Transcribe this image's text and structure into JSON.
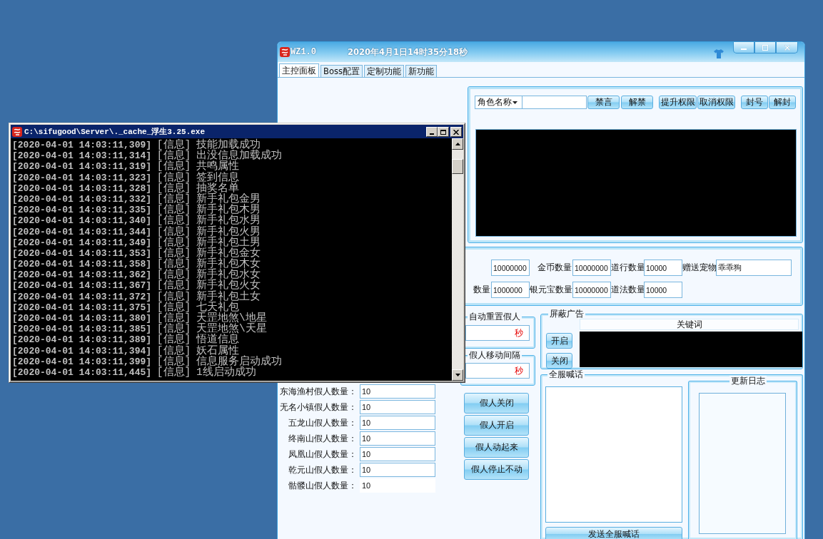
{
  "main_window": {
    "title": "WZ1.0",
    "clock": "2020年4月1日14时35分18秒",
    "tabs": [
      {
        "label": "主控面板",
        "selected": true
      },
      {
        "label": "Boss配置",
        "selected": false
      },
      {
        "label": "定制功能",
        "selected": false
      },
      {
        "label": "新功能",
        "selected": false
      }
    ],
    "player_panel": {
      "search_by": "角色名称",
      "button_groups": [
        [
          "禁言",
          "解禁"
        ],
        [
          "提升权限",
          "取消权限"
        ],
        [
          "封号",
          "解封"
        ]
      ]
    },
    "grant_panel": {
      "rows": [
        [
          {
            "value": "10000000"
          },
          {
            "label": "金币数量",
            "value": "10000000"
          },
          {
            "label": "道行数量",
            "value": "10000"
          },
          {
            "label": "赠送宠物",
            "value": "乖乖狗"
          }
        ],
        [
          {
            "label": "数量",
            "value": "1000000"
          },
          {
            "label": "银元宝数量",
            "value": "10000000"
          },
          {
            "label": "道法数量",
            "value": "10000"
          }
        ]
      ]
    },
    "fake_players": {
      "rows": [
        {
          "label": "东海渔村假人数量：",
          "value": "10",
          "kind": "input"
        },
        {
          "label": "无名小镇假人数量：",
          "value": "10",
          "kind": "input"
        },
        {
          "label": "五龙山假人数量：",
          "value": "10",
          "kind": "input"
        },
        {
          "label": "终南山假人数量：",
          "value": "10",
          "kind": "input"
        },
        {
          "label": "凤凰山假人数量：",
          "value": "10",
          "kind": "input"
        },
        {
          "label": "乾元山假人数量：",
          "value": "10",
          "kind": "input"
        },
        {
          "label": "骷髅山假人数量：",
          "value": "10",
          "kind": "plain"
        }
      ]
    },
    "timers": [
      {
        "title": "自动重置假人",
        "unit": "秒"
      },
      {
        "title": "假人移动间隔",
        "unit": "秒"
      }
    ],
    "fake_buttons": [
      "假人关闭",
      "假人开启",
      "假人动起来",
      "假人停止不动"
    ],
    "ad_filter": {
      "title": "屏蔽广告",
      "column": "关键词",
      "buttons": [
        "开启",
        "关闭"
      ]
    },
    "broadcast": {
      "title": "全服喊话",
      "send_button": "发送全服喊话",
      "changelog_title": "更新日志"
    }
  },
  "console_window": {
    "title": "C:\\sifugood\\Server\\._cache_浮生3.25.exe",
    "lines": [
      {
        "time": "[2020-04-01 14:03:11,309]",
        "level": "[信息]",
        "message": "技能加载成功"
      },
      {
        "time": "[2020-04-01 14:03:11,314]",
        "level": "[信息]",
        "message": "出没信息加载成功"
      },
      {
        "time": "[2020-04-01 14:03:11,319]",
        "level": "[信息]",
        "message": "共鸣属性"
      },
      {
        "time": "[2020-04-01 14:03:11,323]",
        "level": "[信息]",
        "message": "签到信息"
      },
      {
        "time": "[2020-04-01 14:03:11,328]",
        "level": "[信息]",
        "message": "抽奖名单"
      },
      {
        "time": "[2020-04-01 14:03:11,332]",
        "level": "[信息]",
        "message": "新手礼包金男"
      },
      {
        "time": "[2020-04-01 14:03:11,335]",
        "level": "[信息]",
        "message": "新手礼包木男"
      },
      {
        "time": "[2020-04-01 14:03:11,340]",
        "level": "[信息]",
        "message": "新手礼包水男"
      },
      {
        "time": "[2020-04-01 14:03:11,344]",
        "level": "[信息]",
        "message": "新手礼包火男"
      },
      {
        "time": "[2020-04-01 14:03:11,349]",
        "level": "[信息]",
        "message": "新手礼包土男"
      },
      {
        "time": "[2020-04-01 14:03:11,353]",
        "level": "[信息]",
        "message": "新手礼包金女"
      },
      {
        "time": "[2020-04-01 14:03:11,358]",
        "level": "[信息]",
        "message": "新手礼包木女"
      },
      {
        "time": "[2020-04-01 14:03:11,362]",
        "level": "[信息]",
        "message": "新手礼包水女"
      },
      {
        "time": "[2020-04-01 14:03:11,367]",
        "level": "[信息]",
        "message": "新手礼包火女"
      },
      {
        "time": "[2020-04-01 14:03:11,372]",
        "level": "[信息]",
        "message": "新手礼包土女"
      },
      {
        "time": "[2020-04-01 14:03:11,375]",
        "level": "[信息]",
        "message": "七天礼包"
      },
      {
        "time": "[2020-04-01 14:03:11,380]",
        "level": "[信息]",
        "message": "天罡地煞\\地星"
      },
      {
        "time": "[2020-04-01 14:03:11,385]",
        "level": "[信息]",
        "message": "天罡地煞\\天星"
      },
      {
        "time": "[2020-04-01 14:03:11,389]",
        "level": "[信息]",
        "message": "悟道信息"
      },
      {
        "time": "[2020-04-01 14:03:11,394]",
        "level": "[信息]",
        "message": "妖石属性"
      },
      {
        "time": "[2020-04-01 14:03:11,399]",
        "level": "[信息]",
        "message": "信息服务启动成功"
      },
      {
        "time": "[2020-04-01 14:03:11,445]",
        "level": "[信息]",
        "message": "1线启动成功"
      }
    ]
  }
}
